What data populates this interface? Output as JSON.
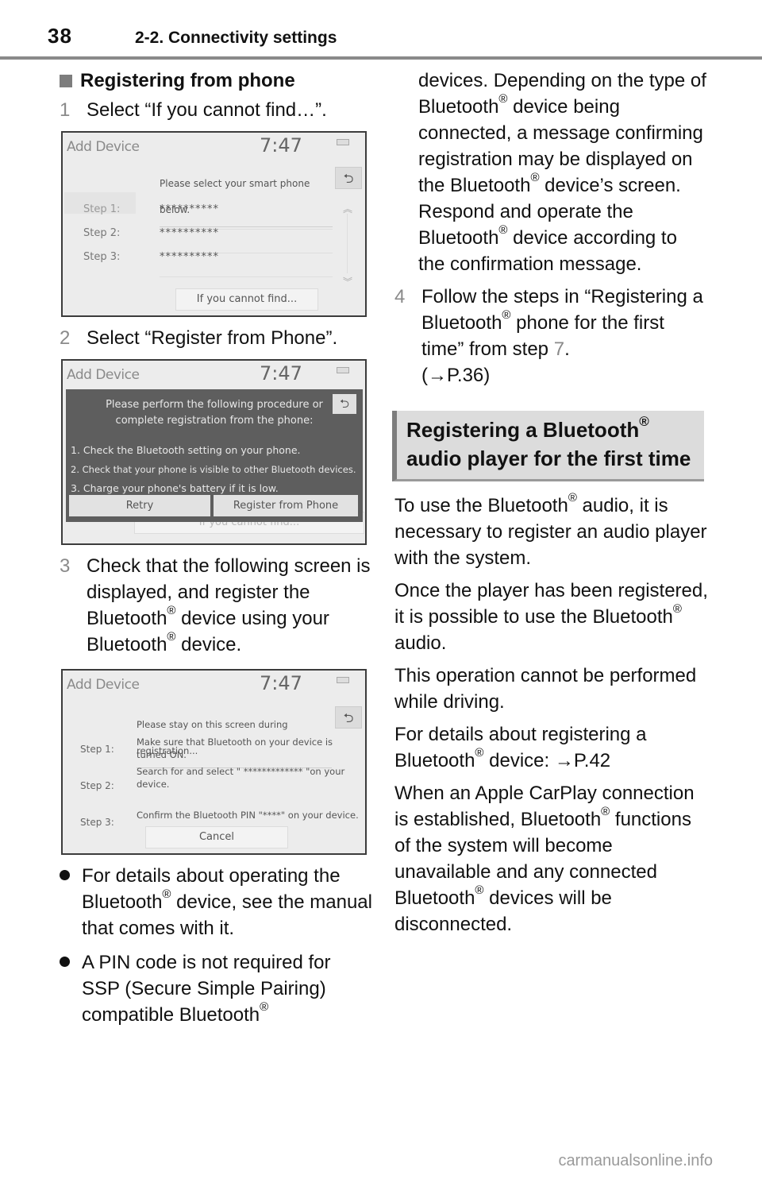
{
  "header": {
    "page_number": "38",
    "section": "2-2. Connectivity settings"
  },
  "left": {
    "subheading": "Registering from phone",
    "steps": [
      {
        "num": "1",
        "text": "Select “If you cannot find…”."
      },
      {
        "num": "2",
        "text": "Select “Register from Phone”."
      },
      {
        "num": "3",
        "text_a": "Check that the following screen is displayed, and register the Bluetooth",
        "text_b": " device using your Bluetooth",
        "text_c": " device."
      }
    ],
    "bullets": [
      {
        "text_a": "For details about operating the Bluetooth",
        "text_b": " device, see the manual that comes with it."
      },
      {
        "text_a": "A PIN code is not required for SSP (Secure Simple Pairing) compatible Bluetooth"
      }
    ]
  },
  "registered_mark": "®",
  "screen1": {
    "title": "Add Device",
    "clock": "7:47",
    "prompt": "Please select your smart phone below.",
    "steps": [
      "Step 1:",
      "Step 2:",
      "Step 3:"
    ],
    "rows": [
      "**********",
      "**********",
      "**********"
    ],
    "button": "If you cannot find...",
    "back_icon": "⮌"
  },
  "screen2": {
    "title": "Add Device",
    "clock": "7:47",
    "message_line1": "Please perform the following procedure or",
    "message_line2": "complete registration from the phone:",
    "list": [
      "1. Check the Bluetooth setting on your phone.",
      "2. Check that your phone is visible to other Bluetooth devices.",
      "3. Charge your phone's battery if it is low."
    ],
    "retry_button": "Retry",
    "register_button": "Register from Phone",
    "background_button": "If you cannot find..."
  },
  "screen3": {
    "title": "Add Device",
    "clock": "7:47",
    "prompt": "Please stay on this screen during registration...",
    "steps": [
      {
        "label": "Step 1:",
        "text": "Make sure that Bluetooth on your device is turned ON."
      },
      {
        "label": "Step 2:",
        "text": "Search for and select \" ************* \"on your device."
      },
      {
        "label": "Step 3:",
        "text": "Confirm the Bluetooth PIN \"****\" on your device."
      }
    ],
    "cancel_button": "Cancel"
  },
  "right": {
    "continuation_a": "devices. Depending on the type of Bluetooth",
    "continuation_b": " device being connected, a message confirming registration may be displayed on the Bluetooth",
    "continuation_c": " device’s screen. Respond and operate the Bluetooth",
    "continuation_d": " device according to the confirmation message.",
    "step4": {
      "num": "4",
      "text_a": "Follow the steps in “Registering a Bluetooth",
      "text_b": " phone for the first time” from step ",
      "step_ref": "7",
      "text_c": ".",
      "page_ref": "(→P.36)"
    },
    "topic_heading_a": "Registering a Bluetooth",
    "topic_heading_b": " audio player for the first time",
    "paragraphs": {
      "p1_a": "To use the Bluetooth",
      "p1_b": " audio, it is necessary to register an audio player with the system.",
      "p2_a": "Once the player has been registered, it is possible to use the Bluetooth",
      "p2_b": " audio.",
      "p3": "This operation cannot be performed while driving.",
      "p4_a": "For details about registering a Bluetooth",
      "p4_b": " device: →P.42",
      "p5_a": "When an Apple CarPlay connection is established, Bluetooth",
      "p5_b": " functions of the system will become unavailable and any connected Bluetooth",
      "p5_c": " devices will be disconnected."
    }
  },
  "footer": {
    "watermark": "carmanualsonline.info"
  }
}
